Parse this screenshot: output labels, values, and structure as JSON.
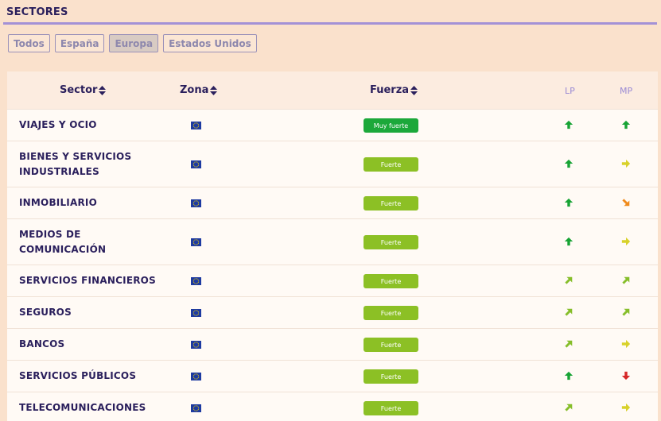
{
  "header": {
    "title": "SECTORES"
  },
  "filters": [
    {
      "label": "Todos",
      "active": false
    },
    {
      "label": "España",
      "active": false
    },
    {
      "label": "Europa",
      "active": true
    },
    {
      "label": "Estados Unidos",
      "active": false
    }
  ],
  "table": {
    "columns": {
      "sector": "Sector",
      "zona": "Zona",
      "fuerza": "Fuerza",
      "lp": "LP",
      "mp": "MP"
    },
    "rows": [
      {
        "sector": [
          "VIAJES Y OCIO"
        ],
        "zona": "eu-flag-icon",
        "fuerza": "Muy fuerte",
        "fuerza_color": "#1ca83a",
        "lp": "up",
        "mp": "up"
      },
      {
        "sector": [
          "BIENES Y SERVICIOS",
          "INDUSTRIALES"
        ],
        "zona": "eu-flag-icon",
        "fuerza": "Fuerte",
        "fuerza_color": "#8cc025",
        "lp": "up",
        "mp": "right"
      },
      {
        "sector": [
          "INMOBILIARIO"
        ],
        "zona": "eu-flag-icon",
        "fuerza": "Fuerte",
        "fuerza_color": "#8cc025",
        "lp": "up",
        "mp": "down-right"
      },
      {
        "sector": [
          "MEDIOS DE",
          "COMUNICACIÓN"
        ],
        "zona": "eu-flag-icon",
        "fuerza": "Fuerte",
        "fuerza_color": "#8cc025",
        "lp": "up",
        "mp": "right"
      },
      {
        "sector": [
          "SERVICIOS FINANCIEROS"
        ],
        "zona": "eu-flag-icon",
        "fuerza": "Fuerte",
        "fuerza_color": "#8cc025",
        "lp": "up-right",
        "mp": "up-right"
      },
      {
        "sector": [
          "SEGUROS"
        ],
        "zona": "eu-flag-icon",
        "fuerza": "Fuerte",
        "fuerza_color": "#8cc025",
        "lp": "up-right",
        "mp": "up-right"
      },
      {
        "sector": [
          "BANCOS"
        ],
        "zona": "eu-flag-icon",
        "fuerza": "Fuerte",
        "fuerza_color": "#8cc025",
        "lp": "up-right",
        "mp": "right"
      },
      {
        "sector": [
          "SERVICIOS PÚBLICOS"
        ],
        "zona": "eu-flag-icon",
        "fuerza": "Fuerte",
        "fuerza_color": "#8cc025",
        "lp": "up",
        "mp": "down"
      },
      {
        "sector": [
          "TELECOMUNICACIONES"
        ],
        "zona": "eu-flag-icon",
        "fuerza": "Fuerte",
        "fuerza_color": "#8cc025",
        "lp": "up-right",
        "mp": "right"
      }
    ]
  },
  "arrow_colors": {
    "up": "#17a334",
    "up-right": "#86be2a",
    "right": "#d8d12a",
    "down-right": "#f08a1b",
    "down": "#d62727"
  }
}
